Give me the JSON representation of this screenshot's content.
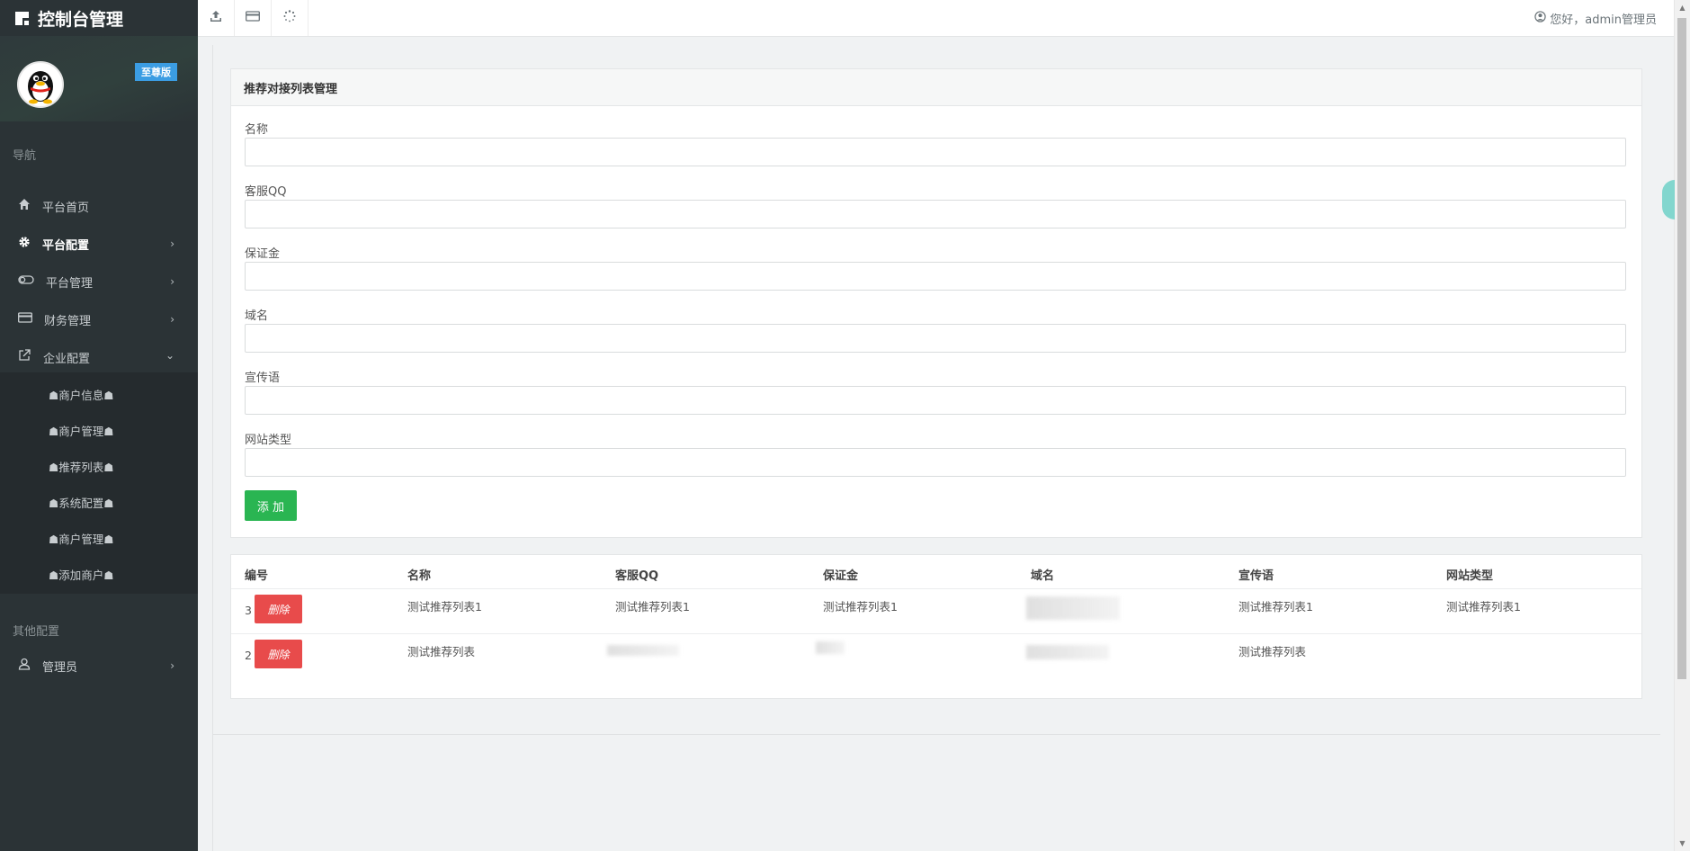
{
  "brand": {
    "title": "控制台管理"
  },
  "profile": {
    "badge": "至尊版"
  },
  "nav": {
    "header": "导航",
    "items": [
      {
        "label": "平台首页",
        "icon": "home-icon"
      },
      {
        "label": "平台配置",
        "icon": "gear-icon"
      },
      {
        "label": "平台管理",
        "icon": "toggle-icon"
      },
      {
        "label": "财务管理",
        "icon": "credit-card-icon"
      },
      {
        "label": "企业配置",
        "icon": "external-link-icon"
      }
    ],
    "sub_items": [
      "☗商户信息☗",
      "☗商户管理☗",
      "☗推荐列表☗",
      "☗系统配置☗",
      "☗商户管理☗",
      "☗添加商户☗"
    ],
    "other_header": "其他配置",
    "admin_label": "管理员"
  },
  "topbar": {
    "greeting": "您好，admin管理员"
  },
  "form": {
    "title": "推荐对接列表管理",
    "fields": [
      {
        "label": "名称",
        "value": ""
      },
      {
        "label": "客服QQ",
        "value": ""
      },
      {
        "label": "保证金",
        "value": ""
      },
      {
        "label": "域名",
        "value": ""
      },
      {
        "label": "宣传语",
        "value": ""
      },
      {
        "label": "网站类型",
        "value": ""
      }
    ],
    "submit_label": "添 加"
  },
  "table": {
    "columns": [
      "编号",
      "名称",
      "客服QQ",
      "保证金",
      "域名",
      "宣传语",
      "网站类型"
    ],
    "delete_label": "删除",
    "rows": [
      {
        "id": "3",
        "name": "测试推荐列表1",
        "qq": "测试推荐列表1",
        "deposit": "测试推荐列表1",
        "domain": "",
        "slogan": "测试推荐列表1",
        "type": "测试推荐列表1"
      },
      {
        "id": "2",
        "name": "测试推荐列表",
        "qq": "",
        "deposit": "",
        "domain": "",
        "slogan": "测试推荐列表",
        "type": ""
      }
    ]
  },
  "colors": {
    "sidebar_bg": "#2b3336",
    "badge": "#3b9de3",
    "add_button": "#2ab552",
    "delete_button": "#e84b4b"
  }
}
